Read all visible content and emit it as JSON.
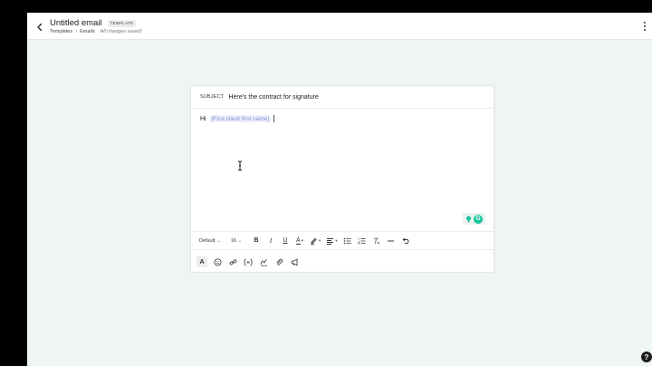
{
  "header": {
    "title": "Untitled email",
    "badge": "TEMPLATE",
    "breadcrumb": [
      "Templates",
      "Emails"
    ],
    "save_status": "All changes saved!"
  },
  "email": {
    "subject_label": "SUBJECT",
    "subject": "Here's the contract for signature",
    "greeting": "Hi",
    "merge_field": "{First client first name}"
  },
  "toolbar": {
    "font_family": "Default",
    "font_size": "16",
    "bold": "B",
    "italic": "I",
    "underline": "U",
    "text_color": "A"
  },
  "insert_toolbar": {
    "text_style": "A"
  },
  "colors": {
    "background": "#eef5f4",
    "merge_field": "#7b8fd1",
    "grammarly": "#15c39a"
  },
  "help": "?"
}
